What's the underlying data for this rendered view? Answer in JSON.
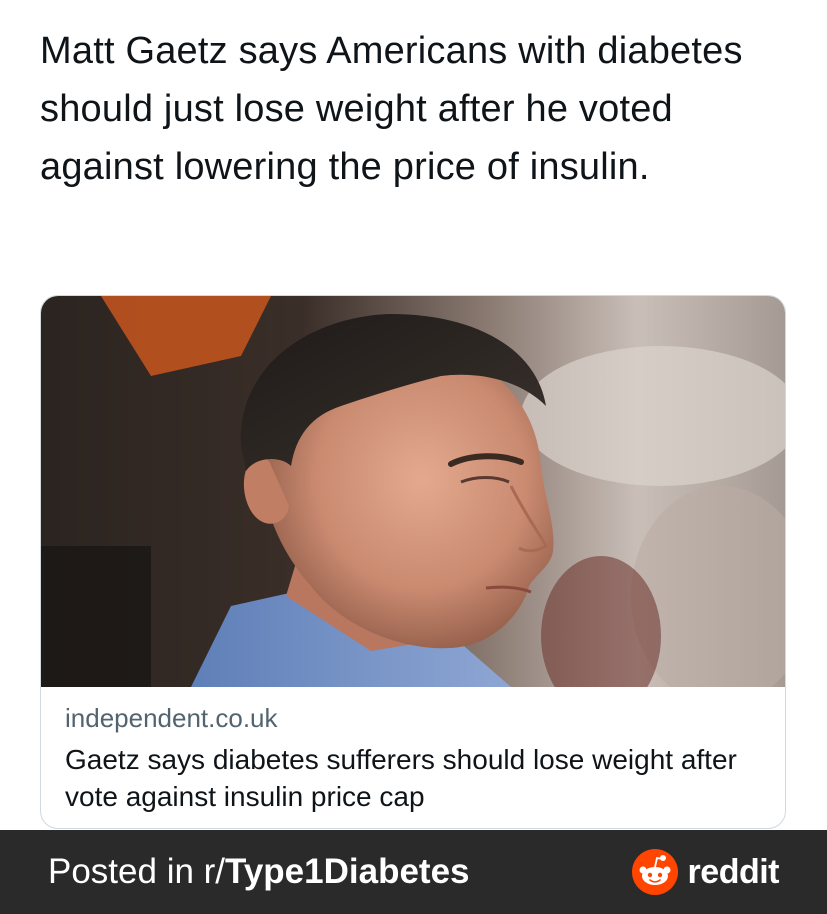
{
  "tweet": {
    "text": "Matt Gaetz says Americans with diabetes should just lose weight after he voted against lowering the price of insulin."
  },
  "link_card": {
    "image_description_icon": "news-photo",
    "domain": "independent.co.uk",
    "title": "Gaetz says diabetes sufferers should lose weight after vote against insulin price cap"
  },
  "footer": {
    "posted_prefix": "Posted in r/",
    "subreddit": "Type1Diabetes",
    "brand": "reddit",
    "brand_color": "#ff4500",
    "background": "#2a2a2b"
  }
}
